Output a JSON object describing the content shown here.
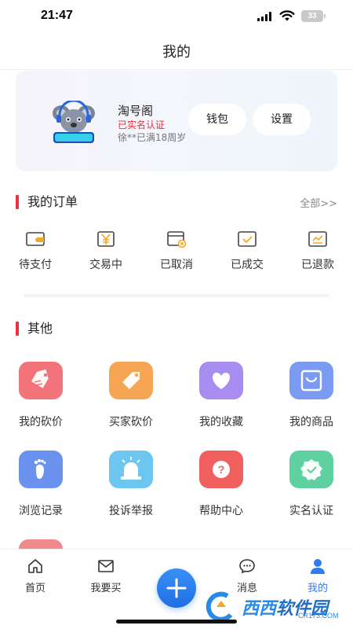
{
  "status_bar": {
    "time": "21:47",
    "battery": "33"
  },
  "nav": {
    "title": "我的"
  },
  "profile": {
    "username": "淘号阁",
    "verify_status": "已实名认证",
    "age_status": "徐**已满18周岁",
    "wallet_label": "钱包",
    "settings_label": "设置"
  },
  "orders": {
    "title": "我的订单",
    "see_all": "全部>>",
    "items": [
      {
        "label": "待支付",
        "icon": "wallet-icon"
      },
      {
        "label": "交易中",
        "icon": "yen-icon"
      },
      {
        "label": "已取消",
        "icon": "cancelled-icon"
      },
      {
        "label": "已成交",
        "icon": "completed-icon"
      },
      {
        "label": "已退款",
        "icon": "refund-icon"
      }
    ]
  },
  "other": {
    "title": "其他",
    "items": [
      {
        "label": "我的砍价",
        "icon": "bargain-tag-icon",
        "color": "#f2737a"
      },
      {
        "label": "买家砍价",
        "icon": "price-tag-icon",
        "color": "#f5a554"
      },
      {
        "label": "我的收藏",
        "icon": "heart-icon",
        "color": "#a98cf0"
      },
      {
        "label": "我的商品",
        "icon": "shopping-bag-icon",
        "color": "#7b9bf2"
      },
      {
        "label": "浏览记录",
        "icon": "footprint-icon",
        "color": "#6b92ee"
      },
      {
        "label": "投诉举报",
        "icon": "alarm-icon",
        "color": "#6cc6f0"
      },
      {
        "label": "帮助中心",
        "icon": "help-icon",
        "color": "#f0605f"
      },
      {
        "label": "实名认证",
        "icon": "verified-badge-icon",
        "color": "#5fd0a0"
      }
    ]
  },
  "tabs": [
    {
      "label": "首页",
      "icon": "home-icon"
    },
    {
      "label": "我要买",
      "icon": "mail-icon"
    },
    {
      "label": "消息",
      "icon": "chat-icon"
    },
    {
      "label": "我的",
      "icon": "person-icon",
      "active": true
    }
  ],
  "watermark": {
    "text": "西西",
    "text2": "软件园",
    "sub": "CR173.COM"
  },
  "colors": {
    "accent": "#e8323c",
    "primary": "#2f7bf0"
  }
}
